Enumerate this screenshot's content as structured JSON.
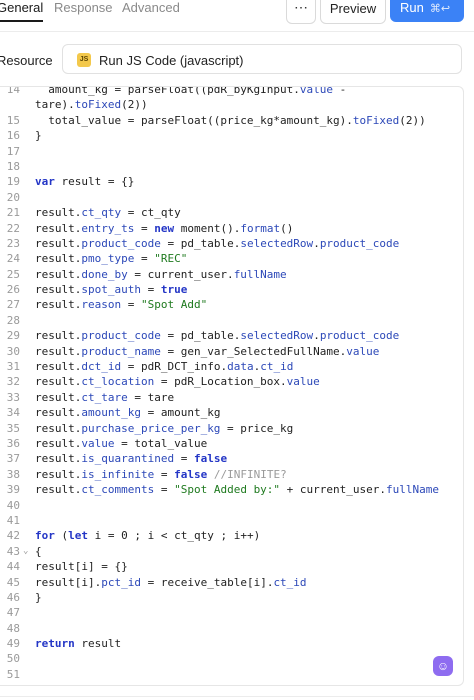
{
  "tabs": [
    {
      "label": "General"
    },
    {
      "label": "Response"
    },
    {
      "label": "Advanced"
    }
  ],
  "toolbar": {
    "more_label": "⋯",
    "preview_label": "Preview",
    "run_label": "Run",
    "run_shortcut": "⌘↩"
  },
  "resource": {
    "label": "Resource",
    "badge": "JS",
    "value": "Run JS Code (javascript)"
  },
  "editor": {
    "lines": [
      {
        "n": "14",
        "t": "  amount_kg = parseFloat((pdR_byKgInput.value -"
      },
      {
        "n": "",
        "t": "tare).toFixed(2))"
      },
      {
        "n": "15",
        "t": "  total_value = parseFloat((price_kg*amount_kg).toFixed(2))"
      },
      {
        "n": "16",
        "t": "}"
      },
      {
        "n": "17",
        "t": ""
      },
      {
        "n": "18",
        "t": ""
      },
      {
        "n": "19",
        "t": "var result = {}"
      },
      {
        "n": "20",
        "t": ""
      },
      {
        "n": "21",
        "t": "result.ct_qty = ct_qty"
      },
      {
        "n": "22",
        "t": "result.entry_ts = new moment().format()"
      },
      {
        "n": "23",
        "t": "result.product_code = pd_table.selectedRow.product_code"
      },
      {
        "n": "24",
        "t": "result.pmo_type = \"REC\""
      },
      {
        "n": "25",
        "t": "result.done_by = current_user.fullName"
      },
      {
        "n": "26",
        "t": "result.spot_auth = true"
      },
      {
        "n": "27",
        "t": "result.reason = \"Spot Add\""
      },
      {
        "n": "28",
        "t": ""
      },
      {
        "n": "29",
        "t": "result.product_code = pd_table.selectedRow.product_code"
      },
      {
        "n": "30",
        "t": "result.product_name = gen_var_SelectedFullName.value"
      },
      {
        "n": "31",
        "t": "result.dct_id = pdR_DCT_info.data.ct_id"
      },
      {
        "n": "32",
        "t": "result.ct_location = pdR_Location_box.value"
      },
      {
        "n": "33",
        "t": "result.ct_tare = tare"
      },
      {
        "n": "34",
        "t": "result.amount_kg = amount_kg"
      },
      {
        "n": "35",
        "t": "result.purchase_price_per_kg = price_kg"
      },
      {
        "n": "36",
        "t": "result.value = total_value"
      },
      {
        "n": "37",
        "t": "result.is_quarantined = false"
      },
      {
        "n": "38",
        "t": "result.is_infinite = false //INFINITE?"
      },
      {
        "n": "39",
        "t": "result.ct_comments = \"Spot Added by:\" + current_user.fullName"
      },
      {
        "n": "40",
        "t": ""
      },
      {
        "n": "41",
        "t": ""
      },
      {
        "n": "42",
        "t": "for (let i = 0 ; i < ct_qty ; i++)"
      },
      {
        "n": "43",
        "t": "{",
        "fold": "⌄"
      },
      {
        "n": "44",
        "t": "result[i] = {}"
      },
      {
        "n": "45",
        "t": "result[i].pct_id = receive_table[i].ct_id"
      },
      {
        "n": "46",
        "t": "}"
      },
      {
        "n": "47",
        "t": ""
      },
      {
        "n": "48",
        "t": ""
      },
      {
        "n": "49",
        "t": "return result"
      },
      {
        "n": "50",
        "t": ""
      },
      {
        "n": "51",
        "t": ""
      }
    ]
  },
  "colors": {
    "accent": "#3b82f6",
    "keyword": "#2436c6",
    "property": "#2c48b8",
    "string": "#1f7a1f",
    "comment": "#9a9a9a"
  },
  "icons": {
    "assistant": "assistant-bot-icon"
  }
}
